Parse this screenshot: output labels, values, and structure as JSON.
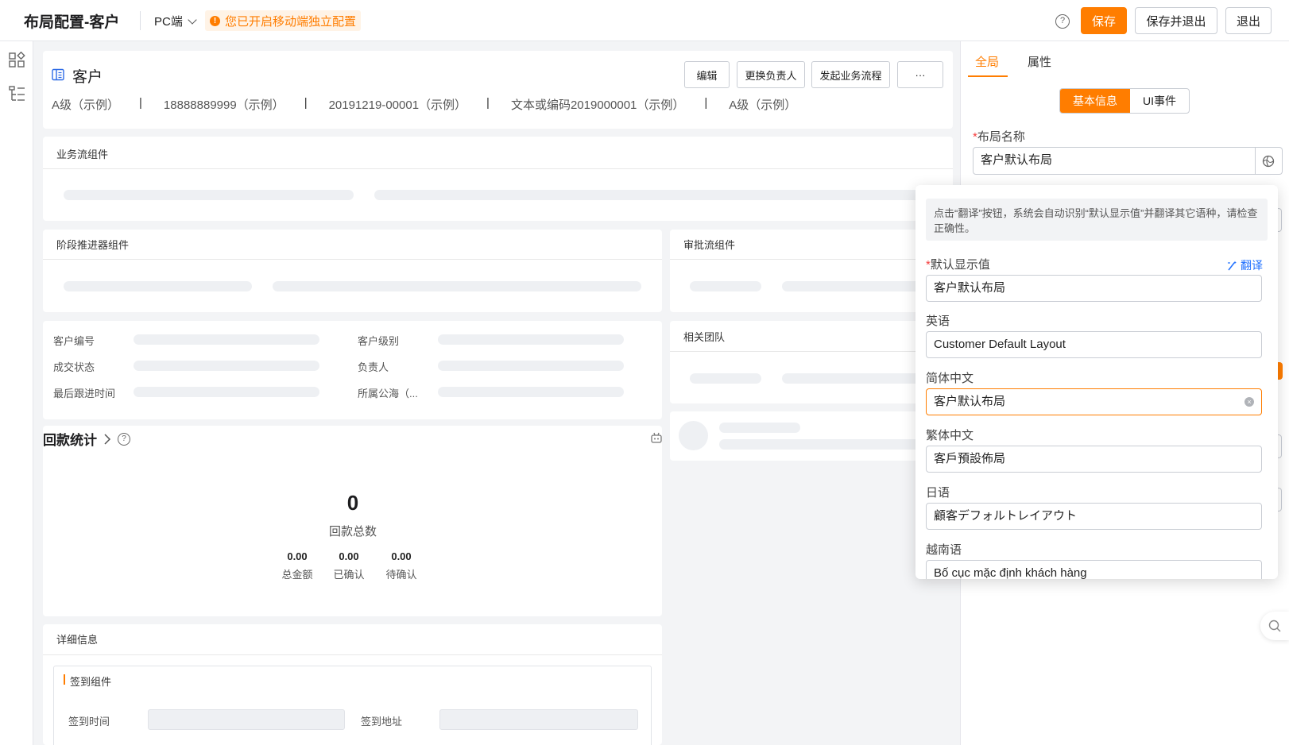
{
  "header": {
    "title": "布局配置-客户",
    "device": "PC端",
    "mobile_notice": "您已开启移动端独立配置",
    "save": "保存",
    "save_exit": "保存并退出",
    "exit": "退出"
  },
  "record": {
    "object_name": "客户",
    "actions": [
      "编辑",
      "更换负责人",
      "发起业务流程",
      "···"
    ],
    "summary": [
      "A级（示例）",
      "18888889999（示例）",
      "20191219-00001（示例）",
      "文本或编码2019000001（示例）",
      "A级（示例）"
    ]
  },
  "components": {
    "bizflow": "业务流组件",
    "stage": "阶段推进器组件",
    "approval": "审批流组件",
    "team": "相关团队",
    "detail": "详细信息",
    "checkin": "签到组件"
  },
  "fields": {
    "left": [
      "客户编号",
      "成交状态",
      "最后跟进时间"
    ],
    "right": [
      "客户级别",
      "负责人",
      "所属公海（..."
    ]
  },
  "payment": {
    "title": "回款统计",
    "total": "0",
    "total_label": "回款总数",
    "stats": [
      {
        "value": "0.00",
        "label": "总金额"
      },
      {
        "value": "0.00",
        "label": "已确认"
      },
      {
        "value": "0.00",
        "label": "待确认"
      }
    ]
  },
  "checkin": {
    "time_label": "签到时间",
    "addr_label": "签到地址"
  },
  "panel": {
    "tabs": [
      "全局",
      "属性"
    ],
    "segments": [
      "基本信息",
      "UI事件"
    ],
    "layout_name_label": "布局名称",
    "layout_name_value": "客户默认布局"
  },
  "translate": {
    "tip": "点击“翻译”按钮，系统会自动识别“默认显示值”并翻译其它语种，请检查正确性。",
    "default_label": "默认显示值",
    "translate_btn": "翻译",
    "default_value": "客户默认布局",
    "langs": [
      {
        "label": "英语",
        "value": "Customer Default Layout"
      },
      {
        "label": "简体中文",
        "value": "客户默认布局"
      },
      {
        "label": "繁体中文",
        "value": "客戶預設佈局"
      },
      {
        "label": "日语",
        "value": "顧客デフォルトレイアウト"
      },
      {
        "label": "越南语",
        "value": "Bố cục mặc định khách hàng"
      }
    ]
  },
  "colors": {
    "accent": "#ff7d00",
    "link": "#1e6fff"
  }
}
